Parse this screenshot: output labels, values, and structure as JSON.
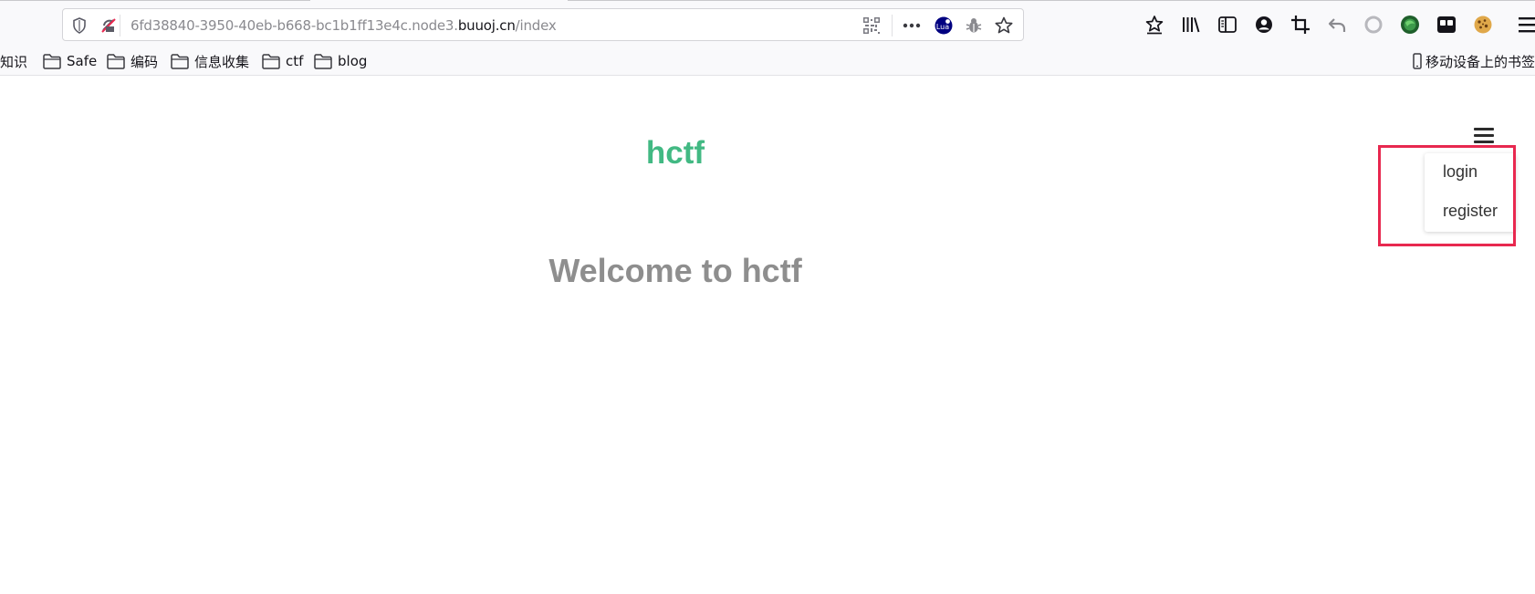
{
  "browser": {
    "url": {
      "prefix": "6fd38840-3950-40eb-b668-bc1b1ff13e4c.node3.",
      "host": "buuoj.cn",
      "path": "/index"
    },
    "toolbar_icons": [
      "shield-icon",
      "tracking-off-icon",
      "qr-code-icon",
      "more-icon",
      "lua-icon",
      "bug-icon",
      "star-icon",
      "reading-list-icon",
      "library-icon",
      "sidebar-icon",
      "account-icon",
      "crop-icon",
      "undo-icon",
      "circle-icon",
      "green-extension-icon",
      "tab-extension-icon",
      "cookie-icon",
      "menu-icon"
    ],
    "lua_label": "Lua",
    "bookmarks": [
      {
        "label": "知识",
        "icon": "none"
      },
      {
        "label": "Safe",
        "icon": "folder-icon"
      },
      {
        "label": "编码",
        "icon": "folder-icon"
      },
      {
        "label": "信息收集",
        "icon": "folder-icon"
      },
      {
        "label": "ctf",
        "icon": "folder-icon"
      },
      {
        "label": "blog",
        "icon": "folder-icon"
      }
    ],
    "mobile_bookmarks": "移动设备上的书签"
  },
  "page": {
    "site_title": "hctf",
    "welcome": "Welcome to hctf",
    "title_color": "#42b983",
    "menu": {
      "items": [
        {
          "label": "login"
        },
        {
          "label": "register"
        }
      ]
    },
    "highlight_color": "#e8284f"
  }
}
